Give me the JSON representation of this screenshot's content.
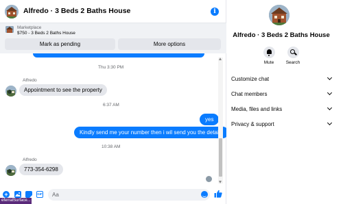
{
  "header": {
    "title": "Alfredo · 3 Beds 2 Baths House",
    "info_icon": "info-icon"
  },
  "listing": {
    "source": "Marketplace",
    "description": "$750 - 3 Beds 2 Baths House",
    "mark_pending_label": "Mark as pending",
    "more_options_label": "More options"
  },
  "messages": {
    "ts1": "Thu 3:30 PM",
    "msg1_sender": "Alfredo",
    "msg1_text": "Appointment to see the property",
    "ts2": "6:37 AM",
    "msg2_text": "yes",
    "msg3_text": "Kindly send me your number then i wil send you the details",
    "ts3": "10:38 AM",
    "msg4_sender": "Alfredo",
    "msg4_text": "773-354-6298"
  },
  "composer": {
    "placeholder": "Aa",
    "gif_label": "GIF"
  },
  "taskbar": {
    "tip": "eferralSurface..."
  },
  "info_panel": {
    "name": "Alfredo · 3 Beds 2 Baths House",
    "mute_label": "Mute",
    "search_label": "Search",
    "sections": [
      {
        "label": "Customize chat"
      },
      {
        "label": "Chat members"
      },
      {
        "label": "Media, files and links"
      },
      {
        "label": "Privacy & support"
      }
    ]
  },
  "colors": {
    "accent": "#0a7cff",
    "bubble_in": "#e4e6eb",
    "listing_bg": "#f0f2f5",
    "secondary_text": "#65676b"
  }
}
